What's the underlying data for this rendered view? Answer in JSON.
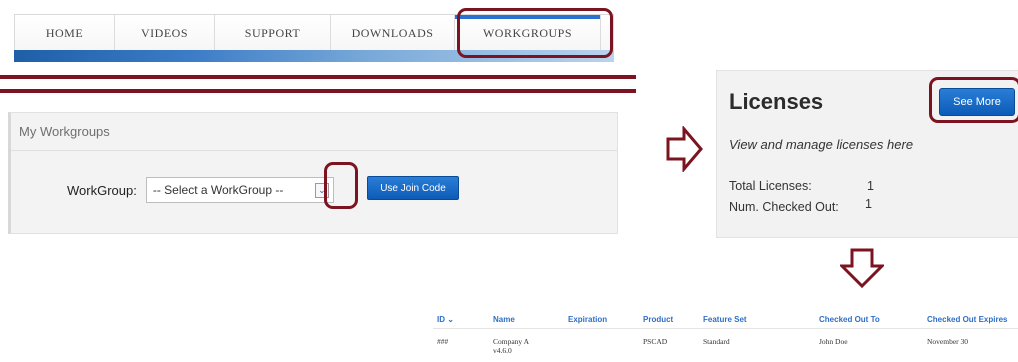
{
  "nav": {
    "tabs": [
      "HOME",
      "VIDEOS",
      "SUPPORT",
      "DOWNLOADS",
      "WORKGROUPS"
    ],
    "active_tab": "WORKGROUPS"
  },
  "workgroups": {
    "title": "My Workgroups",
    "label": "WorkGroup:",
    "select_value": "-- Select a WorkGroup --",
    "join_button": "Use Join Code"
  },
  "licenses": {
    "title": "Licenses",
    "see_more": "See More",
    "description": "View and manage licenses here",
    "total_label": "Total Licenses:",
    "total_value": "1",
    "checked_out_label": "Num. Checked Out:",
    "checked_out_value": "1"
  },
  "table": {
    "headers": [
      "ID",
      "Name",
      "Expiration",
      "Product",
      "Feature Set",
      "Checked Out To",
      "Checked Out Expires"
    ],
    "sort_indicator": "⌄",
    "rows": [
      {
        "id": "###",
        "name_line1": "Company A",
        "name_line2": "v4.6.0",
        "expiration": "",
        "product": "PSCAD",
        "feature_set": "Standard",
        "checked_out_to": "John Doe",
        "checked_out_expires": "November 30"
      }
    ]
  },
  "colors": {
    "highlight": "#7b1420",
    "primary_button": "#0c5bb8",
    "nav_accent": "#2b6fd0",
    "link_blue": "#2f6fc9"
  },
  "icons": [
    "chevron-down-icon",
    "arrow-right-outline-icon",
    "arrow-down-outline-icon"
  ]
}
